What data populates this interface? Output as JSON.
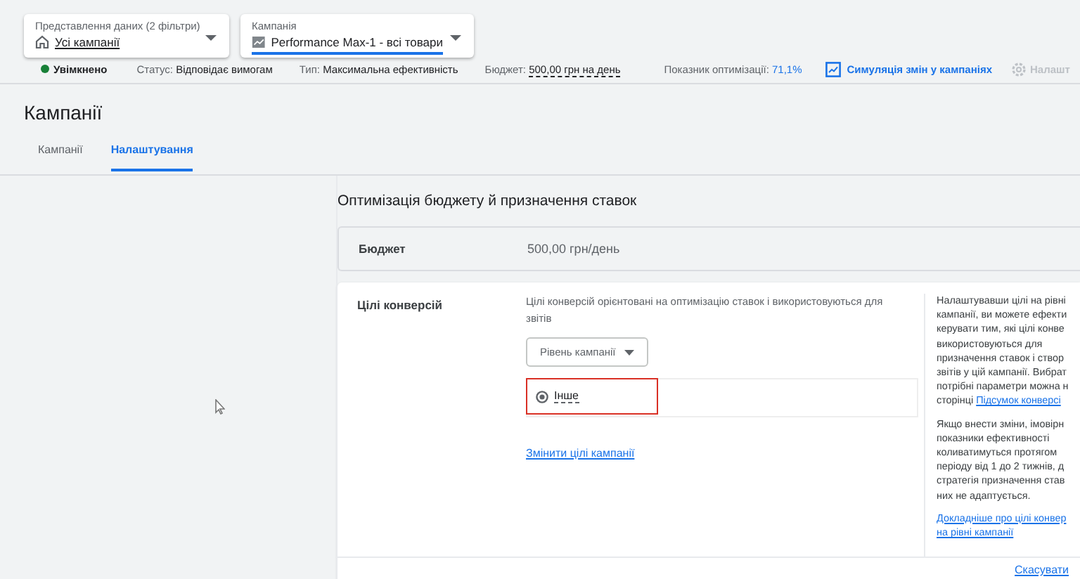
{
  "filters": [
    {
      "kind": "view",
      "label": "Представлення даних (2 фільтри)",
      "value": "Усі кампанії",
      "underlined": false
    },
    {
      "kind": "campaign",
      "label": "Кампанія",
      "value": "Performance Max-1 - всі товари",
      "underlined": true
    }
  ],
  "status_bar": {
    "state": "Увімкнено",
    "status_label": "Статус:",
    "status_value": "Відповідає вимогам",
    "type_label": "Тип:",
    "type_value": "Максимальна ефективність",
    "budget_label": "Бюджет:",
    "budget_value": "500,00 грн на день",
    "score_label": "Показник оптимізації:",
    "score_value": "71,1%",
    "simulate": "Симуляція змін у кампаніях",
    "settings": "Налашт"
  },
  "page_title": "Кампанії",
  "tabs": [
    {
      "label": "Кампанії",
      "selected": false
    },
    {
      "label": "Налаштування",
      "selected": true
    }
  ],
  "section_title": "Оптимізація бюджету й призначення ставок",
  "budget": {
    "label": "Бюджет",
    "value": "500,00 грн/день"
  },
  "goals": {
    "label": "Цілі конверсій",
    "description": "Цілі конверсій орієнтовані на оптимізацію ставок і використовуються для звітів",
    "level_dropdown": "Рівень кампанії",
    "goal": "Інше",
    "change_link": "Змінити цілі кампанії",
    "help_lines": [
      "Налаштувавши цілі на рівні",
      "кампанії, ви можете ефекти",
      "керувати тим, які цілі конве",
      "використовуються для",
      "призначення ставок і створ",
      "звітів у цій кампанії. Вибрат",
      "потрібні параметри можна н"
    ],
    "help_link_prefix": "сторінці",
    "help_link": "Підсумок конверсі",
    "help_lines_2": [
      "Якщо внести зміни, імовірн",
      "показники ефективності",
      "коливатимуться протягом",
      "періоду від 1 до 2 тижнів, д",
      "стратегія призначення став",
      "них не адаптується."
    ],
    "learn_more": [
      "Докладніше про цілі конвер",
      "на рівні кампанії"
    ]
  },
  "cancel": "Скасувати"
}
